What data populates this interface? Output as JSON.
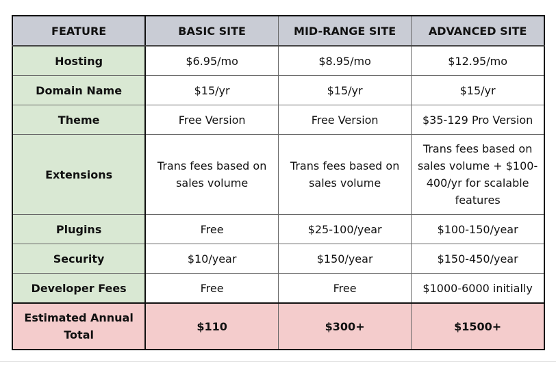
{
  "headers": [
    "FEATURE",
    "BASIC SITE",
    "MID-RANGE SITE",
    "ADVANCED SITE"
  ],
  "rows": [
    {
      "feature": "Hosting",
      "basic": "$6.95/mo",
      "mid": "$8.95/mo",
      "advanced": "$12.95/mo"
    },
    {
      "feature": "Domain Name",
      "basic": "$15/yr",
      "mid": "$15/yr",
      "advanced": "$15/yr"
    },
    {
      "feature": "Theme",
      "basic": "Free Version",
      "mid": "Free Version",
      "advanced": "$35-129 Pro Version"
    },
    {
      "feature": "Extensions",
      "basic": "Trans fees based on sales volume",
      "mid": "Trans fees based on sales volume",
      "advanced": "Trans fees based on sales volume + $100-400/yr for scalable features"
    },
    {
      "feature": "Plugins",
      "basic": "Free",
      "mid": "$25-100/year",
      "advanced": "$100-150/year"
    },
    {
      "feature": "Security",
      "basic": "$10/year",
      "mid": "$150/year",
      "advanced": "$150-450/year"
    },
    {
      "feature": "Developer Fees",
      "basic": "Free",
      "mid": "Free",
      "advanced": "$1000-6000 initially"
    }
  ],
  "total": {
    "feature": "Estimated Annual Total",
    "basic": "$110",
    "mid": "$300+",
    "advanced": "$1500+"
  },
  "colors": {
    "header": "#c9ccd5",
    "feature_column": "#d9e8d3",
    "total_row": "#f4cccc"
  }
}
